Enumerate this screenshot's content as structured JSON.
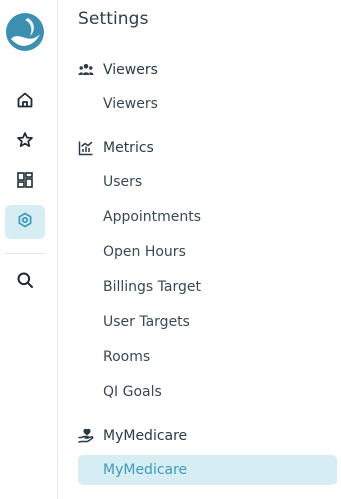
{
  "nav": {
    "logo": "logo-icon",
    "items": [
      {
        "name": "home",
        "icon": "home-icon",
        "active": false
      },
      {
        "name": "favorites",
        "icon": "star-icon",
        "active": false
      },
      {
        "name": "dashboards",
        "icon": "dashboard-icon",
        "active": false
      },
      {
        "name": "settings",
        "icon": "settings-icon",
        "active": true
      },
      {
        "name": "search",
        "icon": "search-icon",
        "active": false
      }
    ]
  },
  "settings": {
    "title": "Settings",
    "sections": [
      {
        "label": "Viewers",
        "icon": "users-icon",
        "items": [
          "Viewers"
        ]
      },
      {
        "label": "Metrics",
        "icon": "chart-icon",
        "items": [
          "Users",
          "Appointments",
          "Open Hours",
          "Billings Target",
          "User Targets",
          "Rooms",
          "QI Goals"
        ]
      },
      {
        "label": "MyMedicare",
        "icon": "hand-heart-icon",
        "items": [
          "MyMedicare"
        ],
        "active_item": "MyMedicare"
      }
    ]
  },
  "colors": {
    "accent": "#3f9bb8",
    "active_bg": "#d6edf3",
    "logo": "#3d8fb0"
  }
}
